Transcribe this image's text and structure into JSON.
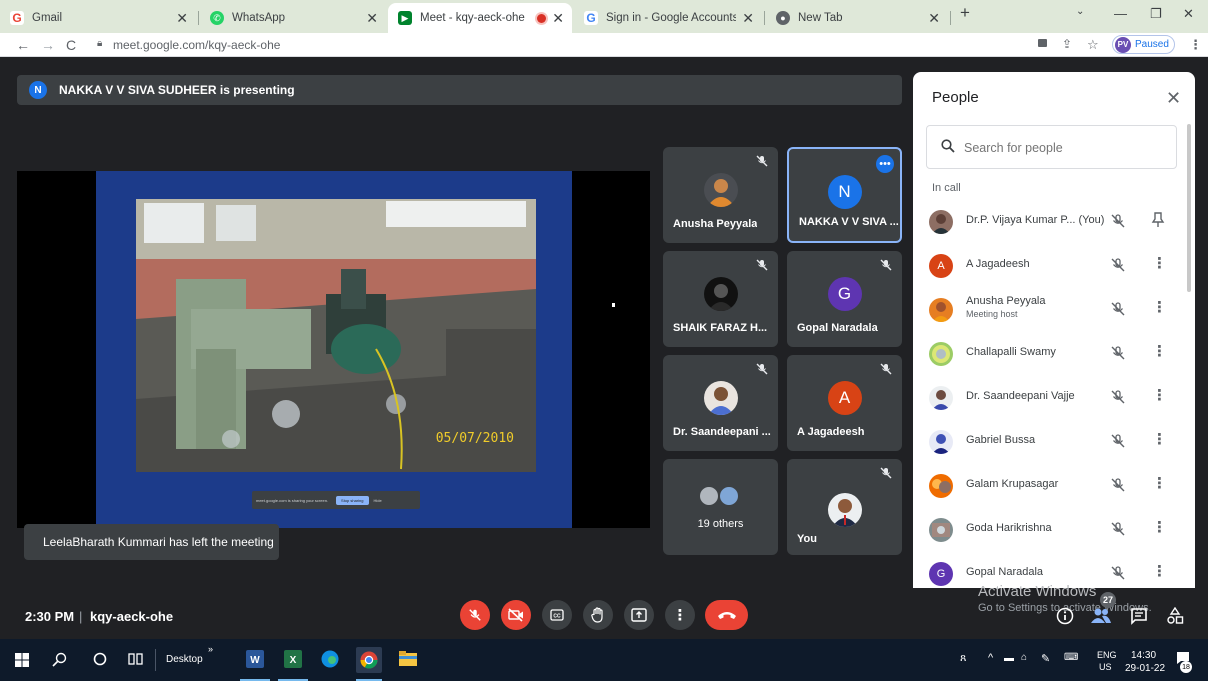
{
  "browser": {
    "tabs": [
      {
        "title": "Gmail",
        "favicon": "gmail-icon",
        "color": "#ea4335"
      },
      {
        "title": "WhatsApp",
        "favicon": "whatsapp-icon",
        "color": "#25d366"
      },
      {
        "title": "Meet - kqy-aeck-ohe",
        "favicon": "meet-icon",
        "color": "#00832d",
        "active": true
      },
      {
        "title": "Sign in - Google Accounts",
        "favicon": "google-icon",
        "color": "#4285f4"
      },
      {
        "title": "New Tab",
        "favicon": "chrome-icon",
        "color": "#5f6368"
      }
    ],
    "url": "meet.google.com/kqy-aeck-ohe",
    "profile_initials": "PV",
    "profile_status": "Paused"
  },
  "meet": {
    "presenting_initial": "N",
    "presenting_banner": "NAKKA V V SIVA SUDHEER is presenting",
    "slide_date": "05/07/2010",
    "share_bar": {
      "text": "meet.google.com is sharing your screen.",
      "stop_label": "Stop sharing",
      "hide_label": "Hide"
    },
    "tiles": [
      {
        "name": "Anusha Peyyala",
        "avatar": "photo",
        "muted": true
      },
      {
        "name": "NAKKA V V SIVA ...",
        "initial": "N",
        "avatar_color": "#1a73e8",
        "muted": false,
        "selected": true
      },
      {
        "name": "SHAIK FARAZ H...",
        "avatar": "photo",
        "muted": true
      },
      {
        "name": "Gopal Naradala",
        "initial": "G",
        "avatar_color": "#5e35b1",
        "muted": true
      },
      {
        "name": "Dr. Saandeepani ...",
        "avatar": "photo",
        "muted": true
      },
      {
        "name": "A Jagadeesh",
        "initial": "A",
        "avatar_color": "#d84315",
        "muted": true
      },
      {
        "name": "19 others",
        "avatar": "group"
      },
      {
        "name": "You",
        "avatar": "photo",
        "muted": true
      }
    ],
    "toast": "LeelaBharath Kummari has left the meeting",
    "time": "2:30 PM",
    "separator": "|",
    "meeting_code": "kqy-aeck-ohe",
    "people_count": "27"
  },
  "people_panel": {
    "title": "People",
    "search_placeholder": "Search for people",
    "section_label": "In call",
    "participants": [
      {
        "name": "Dr.P. Vijaya Kumar P...  (You)",
        "avatar": "photo",
        "color": "#8d6e63",
        "pinnable": true
      },
      {
        "name": "A Jagadeesh",
        "initial": "A",
        "color": "#d84315"
      },
      {
        "name": "Anusha Peyyala",
        "subtitle": "Meeting host",
        "avatar": "photo",
        "color": "#e67e22"
      },
      {
        "name": "Challapalli Swamy",
        "avatar": "photo",
        "color": "#9ccc65"
      },
      {
        "name": "Dr. Saandeepani Vajje",
        "avatar": "photo",
        "color": "#6d4c41"
      },
      {
        "name": "Gabriel Bussa",
        "avatar": "photo",
        "color": "#3f51b5"
      },
      {
        "name": "Galam Krupasagar",
        "avatar": "photo",
        "color": "#ef6c00"
      },
      {
        "name": "Goda Harikrishna",
        "avatar": "photo",
        "color": "#7e8c8d"
      },
      {
        "name": "Gopal Naradala",
        "initial": "G",
        "color": "#5e35b1"
      }
    ]
  },
  "windows": {
    "activate_title": "Activate Windows",
    "activate_sub": "Go to Settings to activate Windows.",
    "taskbar_desktop": "Desktop",
    "lang_line1": "ENG",
    "lang_line2": "US",
    "clock_time": "14:30",
    "clock_date": "29-01-22",
    "notification_count": "18"
  }
}
